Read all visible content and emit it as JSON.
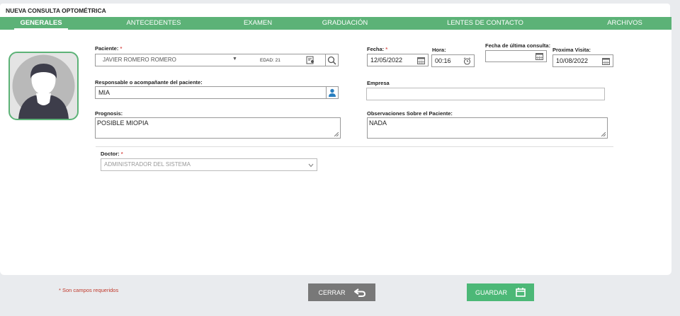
{
  "title": "NUEVA CONSULTA OPTOMÉTRICA",
  "tabs": [
    {
      "label": "GENERALES"
    },
    {
      "label": "ANTECEDENTES"
    },
    {
      "label": "EXAMEN"
    },
    {
      "label": "GRADUACIÓN"
    },
    {
      "label": "LENTES DE CONTACTO"
    },
    {
      "label": "ARCHIVOS"
    }
  ],
  "form": {
    "paciente_label": "Paciente:",
    "paciente_value": "JAVIER ROMERO ROMERO",
    "edad": "EDAD: 21",
    "fecha_label": "Fecha:",
    "fecha_value": "12/05/2022",
    "hora_label": "Hora:",
    "hora_value": "00:16",
    "ultima_label": "Fecha de última consulta:",
    "ultima_value": "",
    "proxima_label": "Proxima Visita:",
    "proxima_value": "10/08/2022",
    "responsable_label": "Responsable o acompañante del paciente:",
    "responsable_value": "MIA",
    "empresa_label": "Empresa",
    "empresa_value": "",
    "prognosis_label": "Prognosis:",
    "prognosis_value": "POSIBLE MIOPIA",
    "observaciones_label": "Observaciones Sobre el Paciente:",
    "observaciones_value": "NADA",
    "doctor_label": "Doctor:",
    "doctor_value": "ADMINISTRADOR DEL SISTEMA",
    "required_mark": "*"
  },
  "footer": {
    "required_note": "* Son campos requeridos",
    "close_label": "CERRAR",
    "save_label": "GUARDAR"
  },
  "colors": {
    "accent": "#5cb277",
    "save": "#4cb877",
    "close": "#787878",
    "required": "#d9534f"
  }
}
